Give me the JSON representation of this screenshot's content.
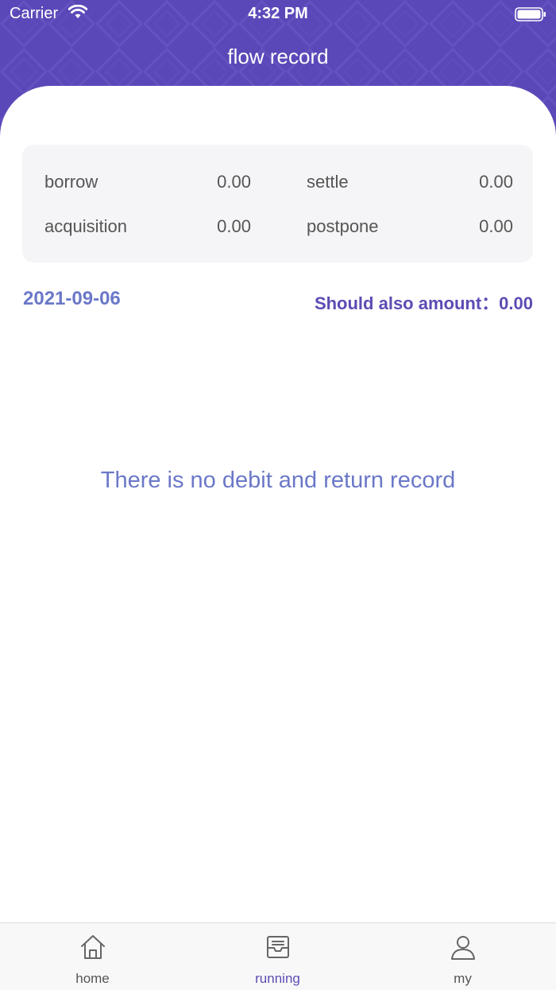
{
  "status_bar": {
    "carrier": "Carrier",
    "time": "4:32 PM"
  },
  "header": {
    "title": "flow record"
  },
  "summary": {
    "items": [
      {
        "label": "borrow",
        "value": "0.00"
      },
      {
        "label": "settle",
        "value": "0.00"
      },
      {
        "label": "acquisition",
        "value": "0.00"
      },
      {
        "label": "postpone",
        "value": "0.00"
      }
    ]
  },
  "record": {
    "date": "2021-09-06",
    "should_label": "Should also amount：",
    "should_value": "0.00"
  },
  "empty_text": "There is no debit and return record",
  "tabs": [
    {
      "label": "home",
      "icon": "home-icon"
    },
    {
      "label": "running",
      "icon": "inbox-icon",
      "active": true
    },
    {
      "label": "my",
      "icon": "user-icon"
    }
  ],
  "colors": {
    "header": "#5b48b8",
    "accent": "#5d4bb4",
    "date": "#6b78c8"
  }
}
